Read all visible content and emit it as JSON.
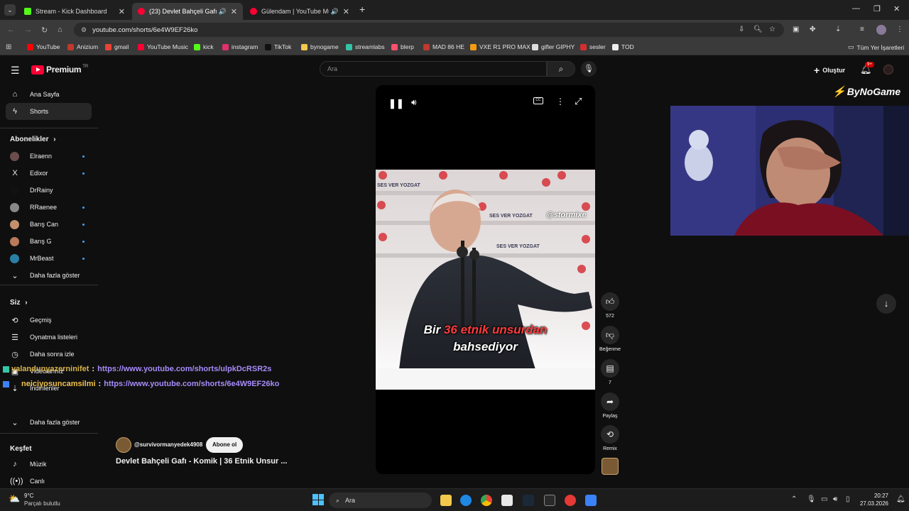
{
  "browser": {
    "tabs": [
      {
        "title": "Stream - Kick Dashboard",
        "color": "#53fc18",
        "active": false
      },
      {
        "title": "(23) Devlet Bahçeli Gafı - Ko",
        "color": "#ff0033",
        "active": true
      },
      {
        "title": "Gülendam | YouTube Music",
        "color": "#ff0033",
        "active": false
      }
    ],
    "new_tab": "+",
    "url": "youtube.com/shorts/6e4W9EF26ko",
    "bookmarks": [
      "YouTube",
      "Anizium",
      "gmail",
      "YouTube Music",
      "kick",
      "instagram",
      "TikTok",
      "bynogame",
      "streamlabs",
      "blerp",
      "MAD 86 HE",
      "VXE R1 PRO MAX",
      "gifler GIPHY",
      "sesler",
      "TOD"
    ],
    "bookmark_colors": [
      "#ff0000",
      "#c0392b",
      "#ea4335",
      "#ff0033",
      "#53fc18",
      "#e1306c",
      "#111111",
      "#f2c94c",
      "#34c3a6",
      "#ff4f6d",
      "#c0392b",
      "#f39c12",
      "#dddddd",
      "#d32f2f",
      "#eeeeee"
    ],
    "all_bookmarks": "Tüm Yer İşaretleri"
  },
  "youtube": {
    "logo": "Premium",
    "logo_sup": "TR",
    "search_placeholder": "Ara",
    "create_label": "Oluştur",
    "notif_badge": "9+",
    "sidebar": {
      "main": [
        "Ana Sayfa",
        "Shorts"
      ],
      "subs_header": "Abonelikler",
      "subs": [
        "Elraenn",
        "Edixor",
        "DrRainy",
        "RRaenee",
        "Barış Can",
        "Barış G",
        "MrBeast"
      ],
      "subs_more": "Daha fazla göster",
      "you_header": "Siz",
      "you": [
        "Geçmiş",
        "Oynatma listeleri",
        "Daha sonra izle",
        "Videolarınız",
        "İndirilenler"
      ],
      "you_more": "Daha fazla göster",
      "explore_header": "Keşfet",
      "explore": [
        "Müzik",
        "Canlı"
      ]
    },
    "video": {
      "watermark": "@stormixe",
      "caption_a": "Bir",
      "caption_b": "36 etnik unsurdan",
      "caption_c": "bahsediyor",
      "banner": "SES VER YOZGAT",
      "channel": "@survivormanyedek4908",
      "subscribe": "Abone ol",
      "title": "Devlet Bahçeli Gafı - Komik | 36 Etnik Unsur ..."
    },
    "actions": {
      "likes": "572",
      "dislike": "Beğenme",
      "comments": "7",
      "share": "Paylaş",
      "remix": "Remix"
    }
  },
  "overlay": {
    "brand": "ByNoGame",
    "chat": [
      {
        "user": "yalandunyazerninifet",
        "msg": "https://www.youtube.com/shorts/ulpkDcRSR2s"
      },
      {
        "user": "neiciyosuncamsilmi",
        "msg": "https://www.youtube.com/shorts/6e4W9EF26ko"
      }
    ]
  },
  "taskbar": {
    "weather_temp": "9°C",
    "weather_desc": "Parçalı bulutlu",
    "search": "Ara",
    "time": "20:27",
    "date": "27.03.2026"
  }
}
